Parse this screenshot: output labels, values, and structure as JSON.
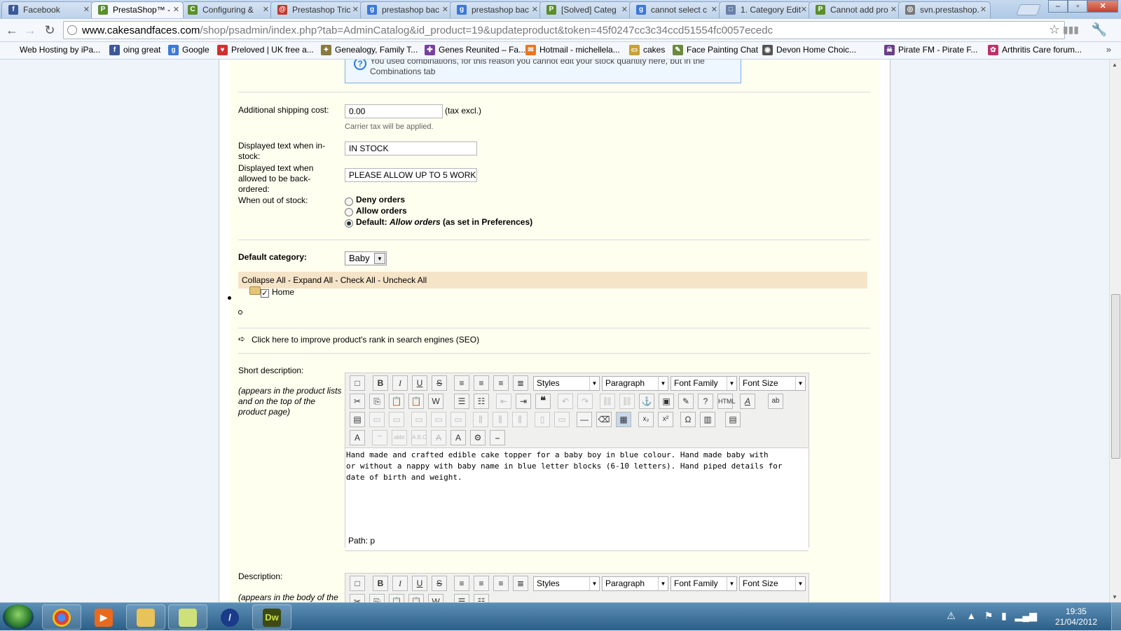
{
  "browser": {
    "tabs": [
      {
        "label": "Facebook",
        "icon": "f",
        "color": "#3b5998"
      },
      {
        "label": "PrestaShop™ - ",
        "icon": "P",
        "color": "#5a8f2a",
        "active": true
      },
      {
        "label": "Configuring &",
        "icon": "C",
        "color": "#5a8f2a"
      },
      {
        "label": "Prestashop Tric",
        "icon": "@",
        "color": "#c0392b"
      },
      {
        "label": "prestashop bac",
        "icon": "g",
        "color": "#3c78d8"
      },
      {
        "label": "prestashop bac",
        "icon": "g",
        "color": "#3c78d8"
      },
      {
        "label": "[Solved] Categ",
        "icon": "P",
        "color": "#5a8f2a"
      },
      {
        "label": "cannot select c",
        "icon": "g",
        "color": "#3c78d8"
      },
      {
        "label": "1. Category Edit",
        "icon": "□",
        "color": "#6a7fa8"
      },
      {
        "label": "Cannot add pro",
        "icon": "P",
        "color": "#5a8f2a"
      },
      {
        "label": "svn.prestashop.",
        "icon": "◎",
        "color": "#777"
      }
    ],
    "url_domain": "www.cakesandfaces.com",
    "url_path": "/shop/psadmin/index.php?tab=AdminCatalog&id_product=19&updateproduct&token=45f0247cc3c34ccd51554fc0057ecedc",
    "bookmarks": [
      {
        "label": "Web Hosting by iPa...",
        "icon": "",
        "color": "#fff"
      },
      {
        "label": "oing great",
        "icon": "f",
        "color": "#3b5998"
      },
      {
        "label": "Google",
        "icon": "g",
        "color": "#3c78d8"
      },
      {
        "label": "Preloved | UK free a...",
        "icon": "♥",
        "color": "#d32f2f"
      },
      {
        "label": "Genealogy, Family T...",
        "icon": "✦",
        "color": "#8a7a3a"
      },
      {
        "label": "Genes Reunited – Fa...",
        "icon": "✚",
        "color": "#7b3fa0"
      },
      {
        "label": "Hotmail - michellela...",
        "icon": "✉",
        "color": "#e87722"
      },
      {
        "label": "cakes",
        "icon": "▭",
        "color": "#c9a233"
      },
      {
        "label": "Face Painting Chat",
        "icon": "✎",
        "color": "#6a8a3a"
      },
      {
        "label": "Devon Home Choic...",
        "icon": "◉",
        "color": "#555"
      },
      {
        "label": "Pirate FM - Pirate F...",
        "icon": "☠",
        "color": "#6b3f8a"
      },
      {
        "label": "Arthritis Care forum...",
        "icon": "✿",
        "color": "#c0306a"
      }
    ],
    "more_bookmarks": "»"
  },
  "form": {
    "info_text": "You used combinations, for this reason you cannot edit your stock quantity here, but in the Combinations tab",
    "shipping_label": "Additional shipping cost:",
    "shipping_value": "0.00",
    "shipping_suffix": "(tax excl.)",
    "shipping_note": "Carrier tax will be applied.",
    "instock_label_1": "Displayed text when in-",
    "instock_label_2": "stock:",
    "instock_value": "IN STOCK",
    "backorder_label_1": "Displayed text when",
    "backorder_label_2": "allowed to be back-",
    "backorder_label_3": "ordered:",
    "backorder_value": "PLEASE ALLOW UP TO 5 WORK",
    "outofstock_label": "When out of stock:",
    "opt_deny": "Deny orders",
    "opt_allow": "Allow orders",
    "opt_default_prefix": "Default:",
    "opt_default_em": "Allow orders",
    "opt_default_suffix": "(as set in Preferences)",
    "default_category_label": "Default category:",
    "default_category_value": "Baby",
    "tree_controls": "Collapse All - Expand All - Check All - Uncheck All",
    "tree_home": "Home",
    "seo_link": "Click here to improve product's rank in search engines (SEO)",
    "short_desc_label": "Short description:",
    "short_desc_note_1": "(appears in the product lists",
    "short_desc_note_2": "and on the top of the",
    "short_desc_note_3": "product page)",
    "short_desc_line_1": "Hand made and crafted edible cake topper for a baby boy in blue colour.  Hand made baby with",
    "short_desc_line_2": "or without a nappy with baby name in blue letter blocks (6-10 letters). Hand piped details for",
    "short_desc_line_3": "date of birth and weight.",
    "path_label": "Path: p",
    "desc_label": "Description:",
    "desc_note_1": "(appears in the body of the"
  },
  "editor": {
    "styles": "Styles",
    "paragraph": "Paragraph",
    "font_family": "Font Family",
    "font_size": "Font Size"
  },
  "taskbar": {
    "time": "19:35",
    "date": "21/04/2012",
    "apps": [
      "chrome",
      "media-player",
      "explorer",
      "folder",
      "ie",
      "dreamweaver"
    ],
    "dw_label": "Dw"
  }
}
